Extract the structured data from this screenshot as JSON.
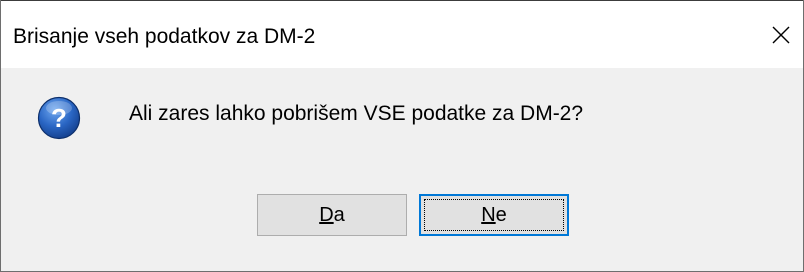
{
  "window": {
    "title": "Brisanje vseh podatkov za DM-2",
    "close_icon": "close-icon"
  },
  "message": {
    "icon": "question-icon",
    "text": "Ali zares lahko pobrišem VSE podatke za DM-2?"
  },
  "buttons": {
    "yes": {
      "mnemonic": "D",
      "rest": "a"
    },
    "no": {
      "mnemonic": "N",
      "rest": "e"
    }
  },
  "colors": {
    "focus_border": "#0078d7",
    "icon_blue": "#1e5bb5",
    "background": "#f0f0f0"
  }
}
